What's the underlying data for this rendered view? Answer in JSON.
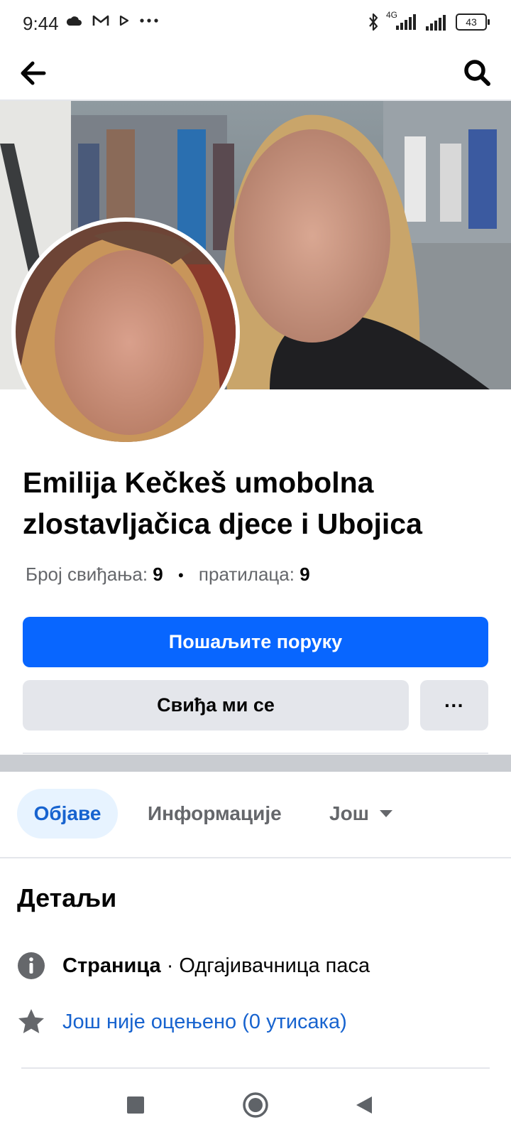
{
  "status_bar": {
    "time": "9:44",
    "network": "4G",
    "battery": "43"
  },
  "page": {
    "name": "Emilija Kečkeš umobolna zlostavljačica djece i Ubojica",
    "likes_label": "Број свиђања:",
    "likes_count": "9",
    "separator": "•",
    "followers_label": "пратилаца:",
    "followers_count": "9"
  },
  "buttons": {
    "message": "Пошаљите поруку",
    "like": "Свиђа ми се",
    "more": "···"
  },
  "tabs": [
    {
      "label": "Објаве",
      "active": true
    },
    {
      "label": "Информације",
      "active": false
    },
    {
      "label": "Још",
      "active": false
    }
  ],
  "details": {
    "title": "Детаљи",
    "category_label": "Страница",
    "category_value": " · Одгајивачница паса",
    "rating": "Још није оцењено (0 утисака)"
  },
  "colors": {
    "primary": "#0866ff",
    "link": "#1763cf",
    "secondary_bg": "#e4e6eb",
    "active_tab_bg": "#e7f3ff"
  }
}
